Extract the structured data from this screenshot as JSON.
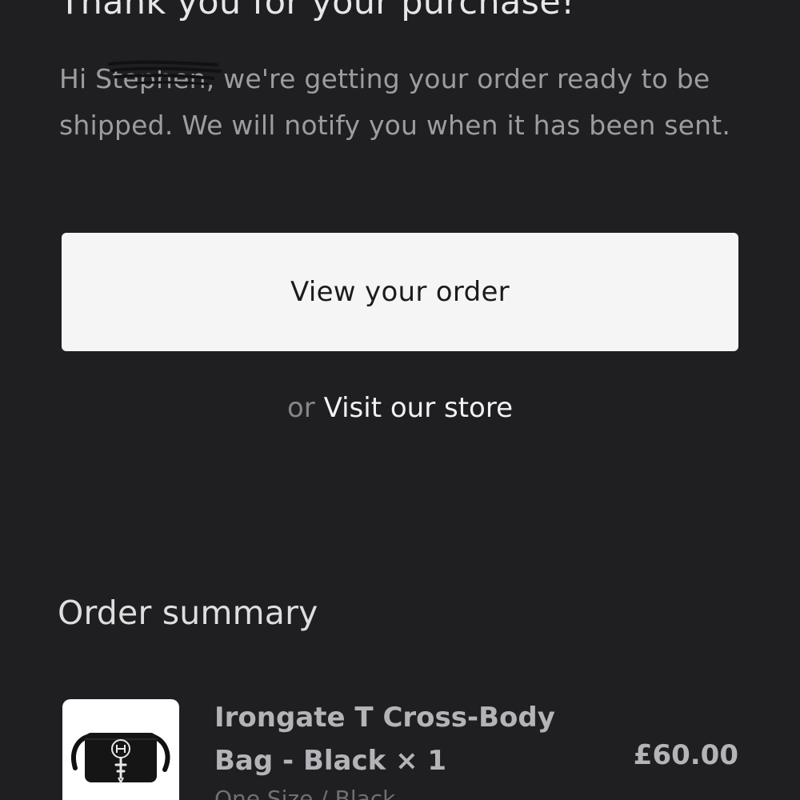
{
  "header": {
    "title": "Thank you for your purchase!"
  },
  "message": {
    "greeting": "Hi ",
    "name": "Stephen",
    "body": ", we're getting your order ready to be shipped. We will notify you when it has been sent."
  },
  "actions": {
    "view_order_label": "View your order",
    "or_label": "or",
    "visit_store_label": "Visit our store"
  },
  "order_summary": {
    "heading": "Order summary",
    "items": [
      {
        "name": "Irongate T Cross-Body Bag - Black × 1",
        "price": "£60.00",
        "variant": "One Size / Black"
      }
    ]
  },
  "colors": {
    "background": "#1f1f22",
    "button_bg": "#f5f5f6",
    "muted_text": "#9c9ca1"
  }
}
